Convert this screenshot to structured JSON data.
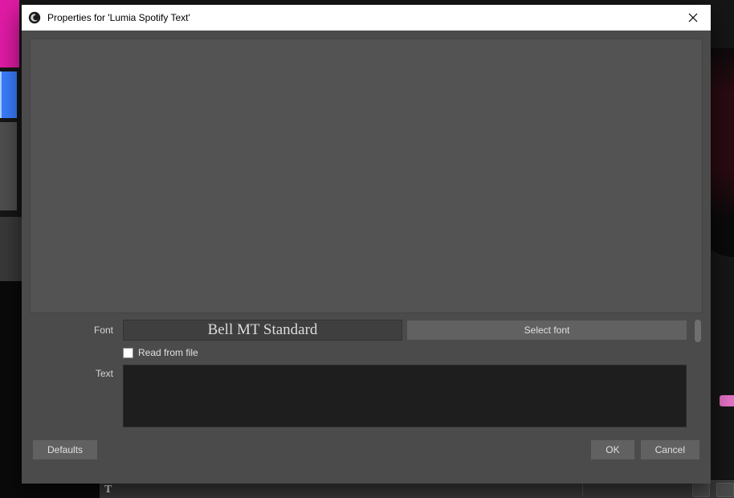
{
  "window": {
    "title": "Properties for 'Lumia Spotify Text'"
  },
  "form": {
    "font_label": "Font",
    "font_value": "Bell MT Standard",
    "select_font_button": "Select font",
    "read_from_file_label": "Read from file",
    "read_from_file_checked": false,
    "text_label": "Text",
    "text_value": ""
  },
  "buttons": {
    "defaults": "Defaults",
    "ok": "OK",
    "cancel": "Cancel"
  },
  "icons": {
    "app": "obs-icon",
    "close": "close-icon"
  }
}
